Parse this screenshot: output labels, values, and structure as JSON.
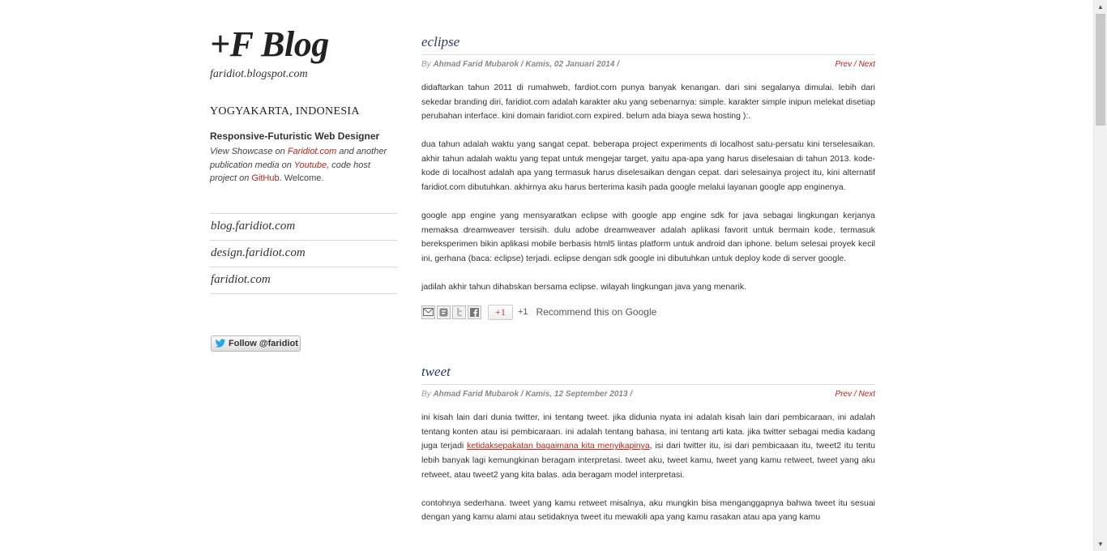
{
  "sidebar": {
    "blog_title": "+F Blog",
    "blog_url": "faridiot.blogspot.com",
    "location": "YOGYAKARTA, INDONESIA",
    "role": "Responsive-Futuristic Web Designer",
    "bio": {
      "text1": "View Showcase on ",
      "link1": "Faridiot.com",
      "text2": " and another publication media on ",
      "link2": "Youtube",
      "text3": ", code host project on ",
      "link3": "GitHub",
      "text4": ". Welcome."
    },
    "links": [
      "blog.faridiot.com",
      "design.faridiot.com",
      "faridiot.com"
    ],
    "follow_label": "Follow @faridiot"
  },
  "posts": [
    {
      "title": "eclipse",
      "by": "By ",
      "author": "Ahmad Farid Mubarok / Kamis, 02 Januari 2014 /",
      "prev": "Prev",
      "sep": " / ",
      "next": "Next",
      "paragraphs": [
        "didaftarkan tahun 2011 di rumahweb, fardiot.com punya banyak kenangan. dari sini segalanya dimulai. lebih dari sekedar branding diri, faridiot.com adalah karakter aku yang sebenarnya: simple. karakter simple inipun melekat disetiap perubahan interface. kini domain faridiot.com expired. belum ada biaya sewa hosting ):.",
        "dua tahun adalah waktu yang sangat cepat. beberapa project experiments di localhost satu-persatu kini terselesaikan. akhir tahun adalah waktu yang tepat untuk mengejar target, yaitu apa-apa yang harus diselesaian di tahun 2013. kode-kode di localhost adalah apa yang termasuk harus diselesaikan dengan cepat. dari selesainya project itu, kini alternatif faridiot.com dibutuhkan. akhirnya aku harus berterima kasih pada google melalui layanan google app enginenya.",
        "google app engine yang mensyaratkan eclipse with google app engine sdk for java sebagai lingkungan kerjanya memaksa dreamweaver tersisih. dulu adobe dreamweaver adalah aplikasi favorit untuk bermain kode, termasuk bereksperimen bikin aplikasi mobile berbasis html5 lintas platform untuk android dan iphone. belum selesai proyek kecil ini, gerhana (baca: eclipse) terjadi. eclipse dengan sdk google ini dibutuhkan untuk deploy kode di server google.",
        "jadilah akhir tahun dihabskan bersama eclipse. wilayah lingkungan java yang menarik."
      ],
      "share": {
        "gplus_label": "+1",
        "gplus_count": "+1",
        "recommend": "Recommend this on Google"
      }
    },
    {
      "title": "tweet",
      "by": "By ",
      "author": "Ahmad Farid Mubarok / Kamis, 12 September 2013 /",
      "prev": "Prev",
      "sep": " / ",
      "next": "Next",
      "p1_a": "ini kisah lain dari dunia twitter, ini tentang tweet. jika didunia nyata ini adalah kisah lain dari pembicaraan, ini adalah tentang konten atau isi pembicaraan. ini adalah tentang bahasa, ini tentang arti kata. jika twitter sebagai media kadang juga terjadi ",
      "p1_link": "ketidaksepakatan bagaimana kita menyikapinya",
      "p1_b": ", isi dari twitter itu, isi dari pembicaaan itu, tweet2 itu tentu lebih banyak lagi kemungkinan beragam interpretasi. tweet aku, tweet kamu, tweet yang kamu retweet, tweet yang aku retweet, atau tweet2 yang kita balas. ada beragam model interpretasi.",
      "p2": "contohnya sederhana. tweet yang kamu retweet misalnya, aku mungkin bisa menganggapnya bahwa tweet itu sesuai dengan yang kamu alami atau setidaknya tweet itu mewakili apa yang kamu rasakan atau apa yang kamu"
    }
  ],
  "colors": {
    "accent_red": "#b8271c",
    "title_blue": "#2a3a6a"
  }
}
